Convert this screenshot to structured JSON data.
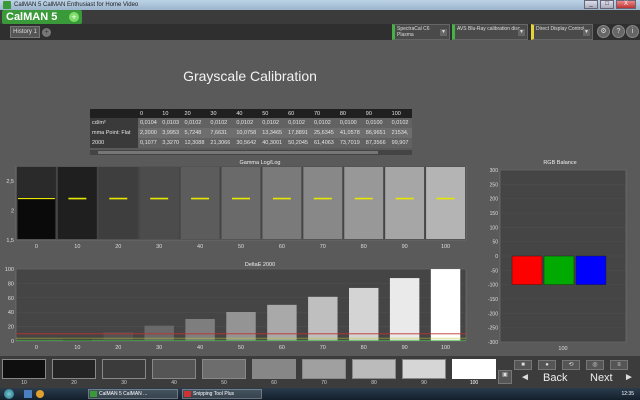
{
  "window": {
    "title": "CalMAN 5 CalMAN Enthusiast for Home Video",
    "buttons": [
      "_",
      "□",
      "X"
    ]
  },
  "logo": {
    "text": "CalMAN 5",
    "badge": "+"
  },
  "tabs": {
    "history": "History 1",
    "add": "+"
  },
  "header": {
    "meter": "SpectraCal C6 Plasma",
    "source": "AVS Blu-Ray calibration disc",
    "display": "Direct Display Control",
    "help_icon": "?",
    "info_icon": "i"
  },
  "page": {
    "title": "Grayscale Calibration"
  },
  "table": {
    "headers": [
      "",
      "0",
      "10",
      "20",
      "30",
      "40",
      "50",
      "60",
      "70",
      "80",
      "90",
      "100"
    ],
    "rows": [
      {
        "label": "cd/m²",
        "values": [
          "0,0104",
          "0,0103",
          "0,0102",
          "0,0102",
          "0,0102",
          "0,0102",
          "0,0102",
          "0,0102",
          "0,0100",
          "0,0100",
          "0,0102"
        ]
      },
      {
        "label": "mma Point: Flat",
        "values": [
          "2,2000",
          "3,9953",
          "5,7248",
          "7,6631",
          "10,0758",
          "13,3465",
          "17,8891",
          "25,6345",
          "41,0578",
          "86,9651",
          "21534,"
        ]
      },
      {
        "label": "2000",
        "values": [
          "0,1077",
          "3,3270",
          "12,3088",
          "21,3066",
          "30,5642",
          "40,3001",
          "50,2045",
          "61,4063",
          "73,7019",
          "87,3566",
          "99,907"
        ]
      }
    ]
  },
  "gamma_chart": {
    "title": "Gamma Log/Log",
    "categories": [
      "0",
      "10",
      "20",
      "30",
      "40",
      "50",
      "60",
      "70",
      "80",
      "90",
      "100"
    ],
    "y_ticks": [
      "2,5",
      "2",
      "1,5"
    ]
  },
  "deltae_chart": {
    "title": "DeltaE 2000",
    "categories": [
      "0",
      "10",
      "20",
      "30",
      "40",
      "50",
      "60",
      "70",
      "80",
      "90",
      "100"
    ],
    "y_ticks": [
      "100",
      "80",
      "60",
      "40",
      "20",
      "0"
    ]
  },
  "rgb_chart": {
    "title": "RGB Balance",
    "category": "100",
    "y_ticks": [
      "300",
      "250",
      "200",
      "150",
      "100",
      "50",
      "0",
      "-50",
      "-100",
      "-150",
      "-200",
      "-250",
      "-300"
    ]
  },
  "chart_data": [
    {
      "type": "line",
      "title": "Gamma Log/Log",
      "categories": [
        "0",
        "10",
        "20",
        "30",
        "40",
        "50",
        "60",
        "70",
        "80",
        "90",
        "100"
      ],
      "series": [
        {
          "values": [
            null,
            2.2,
            2.2,
            2.2,
            2.2,
            2.2,
            2.2,
            2.2,
            2.2,
            2.2,
            2.2
          ]
        },
        {
          "values": [
            2.2,
            null,
            null,
            null,
            null,
            null,
            null,
            null,
            null,
            null,
            null
          ]
        }
      ],
      "ylim": [
        1.5,
        2.75
      ]
    },
    {
      "type": "bar",
      "title": "DeltaE 2000",
      "categories": [
        "0",
        "10",
        "20",
        "30",
        "40",
        "50",
        "60",
        "70",
        "80",
        "90",
        "100"
      ],
      "values": [
        0.1,
        3.3,
        12.3,
        21.3,
        30.6,
        40.3,
        50.2,
        61.4,
        73.7,
        87.4,
        99.9
      ],
      "ylim": [
        0,
        100
      ]
    },
    {
      "type": "bar",
      "title": "RGB Balance",
      "categories": [
        "100"
      ],
      "series": [
        {
          "values": [
            -100
          ],
          "color": "#ff0000"
        },
        {
          "values": [
            -100
          ],
          "color": "#00aa00"
        },
        {
          "values": [
            -100
          ],
          "color": "#0000ff"
        }
      ],
      "ylim": [
        -300,
        300
      ]
    }
  ],
  "swatches": {
    "labels": [
      "10",
      "20",
      "30",
      "40",
      "50",
      "60",
      "70",
      "80",
      "90",
      "100"
    ],
    "selected": "100"
  },
  "nav": {
    "back": "Back",
    "next": "Next"
  },
  "taskbar": {
    "items": [
      "CalMAN 5 CalMAN ...",
      "Snipping Tool Plus"
    ],
    "clock": "12:35"
  }
}
